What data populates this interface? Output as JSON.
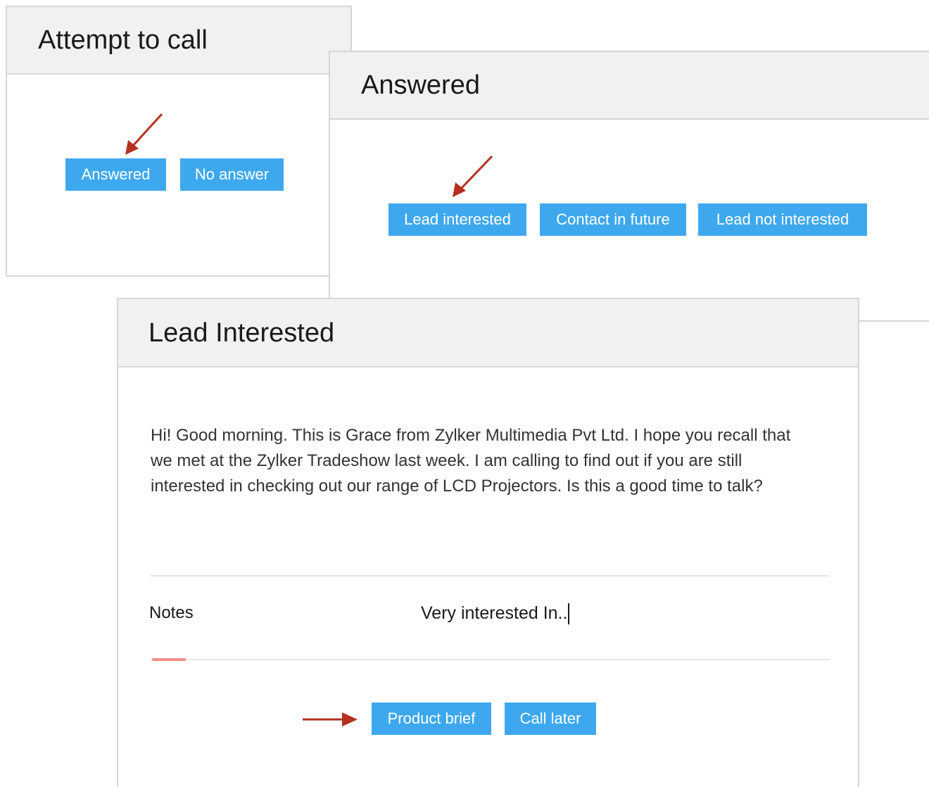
{
  "attempt_card": {
    "title": "Attempt to call",
    "buttons": [
      "Answered",
      "No answer"
    ]
  },
  "answered_card": {
    "title": "Answered",
    "buttons": [
      "Lead interested",
      "Contact in future",
      "Lead not interested"
    ]
  },
  "lead_card": {
    "title": "Lead Interested",
    "script": "Hi! Good morning. This is Grace from Zylker Multimedia Pvt Ltd. I hope you recall that we met at the Zylker Tradeshow last week. I am calling to find out if you are still interested in checking out our range of LCD Projectors. Is this a good time to talk?",
    "notes_label": "Notes",
    "notes_value": "Very interested In..",
    "buttons": [
      "Product brief",
      "Call later"
    ]
  },
  "colors": {
    "button_bg": "#3ea8ee",
    "arrow": "#b5301f",
    "header_bg": "#f0f1f0",
    "focus_underline": "#f28b86"
  }
}
